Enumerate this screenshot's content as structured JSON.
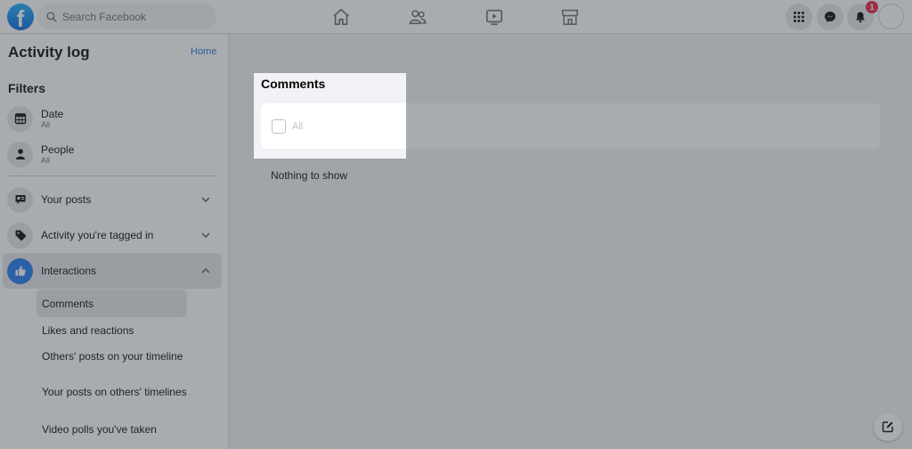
{
  "topbar": {
    "search_placeholder": "Search Facebook",
    "logo_letter": "f",
    "nav_icons": [
      "home-icon",
      "friends-icon",
      "watch-icon",
      "marketplace-icon"
    ],
    "notifications_count": "1"
  },
  "sidebar": {
    "title": "Activity log",
    "home_link": "Home",
    "filters_heading": "Filters",
    "filters": [
      {
        "label": "Date",
        "value": "All",
        "icon": "calendar-icon"
      },
      {
        "label": "People",
        "value": "All",
        "icon": "person-icon"
      }
    ],
    "sections": [
      {
        "label": "Your posts",
        "icon": "posts-icon",
        "expanded": false
      },
      {
        "label": "Activity you're tagged in",
        "icon": "tag-icon",
        "expanded": false
      },
      {
        "label": "Interactions",
        "icon": "like-icon",
        "expanded": true
      }
    ],
    "interactions_items": [
      {
        "label": "Comments",
        "active": true
      },
      {
        "label": "Likes and reactions"
      },
      {
        "label": "Others' posts on your timeline"
      },
      {
        "label": "Your posts on others' timelines"
      },
      {
        "label": "Video polls you've taken"
      }
    ]
  },
  "main": {
    "title": "Comments",
    "checkbox_label": "All",
    "empty_text": "Nothing to show"
  },
  "colors": {
    "brand_blue": "#1877f2",
    "badge_red": "#e41e3f",
    "link_blue": "#216fdb"
  }
}
